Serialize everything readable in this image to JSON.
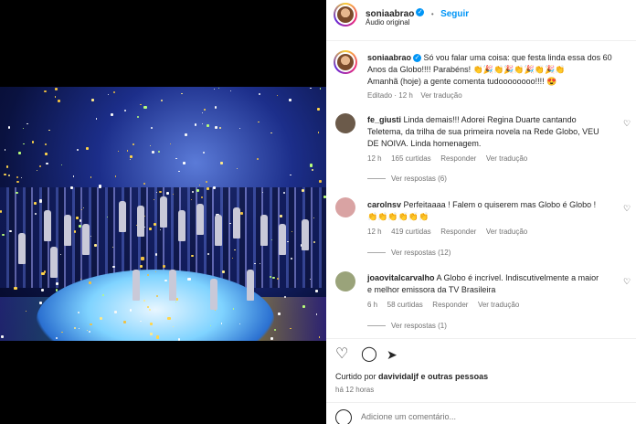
{
  "header": {
    "username": "soniaabrao",
    "follow_label": "Seguir",
    "subtitle": "Áudio original",
    "dot": "•"
  },
  "caption": {
    "username": "soniaabrao",
    "text_line1": "Só vou falar uma coisa: que festa linda essa dos 60",
    "text_line2": "Anos da Globo!!!! Parabéns! 👏🎉👏🎉👏🎉👏🎉👏",
    "text_line3": "Amanhã (hoje) a gente comenta tudoooooooo!!!! 😍",
    "meta_edited": "Editado · 12 h",
    "meta_translate": "Ver tradução"
  },
  "comments": [
    {
      "username": "fe_giusti",
      "line1": "Linda demais!!! Adorei Regina Duarte cantando",
      "line2": "Teletema, da trilha de sua primeira novela na Rede Globo, VEU",
      "line3": "DE NOIVA. Linda homenagem.",
      "time": "12 h",
      "likes": "165 curtidas",
      "reply": "Responder",
      "translate": "Ver tradução",
      "view_replies": "Ver respostas (6)"
    },
    {
      "username": "carolnsv",
      "line1": "Perfeitaaaa ! Falem o quiserem mas Globo é Globo !",
      "line2": "👏👏👏👏👏👏",
      "line3": "",
      "time": "12 h",
      "likes": "419 curtidas",
      "reply": "Responder",
      "translate": "Ver tradução",
      "view_replies": "Ver respostas (12)"
    },
    {
      "username": "joaovitalcarvalho",
      "line1": "A Globo é incrível. Indiscutivelmente a maior",
      "line2": "e melhor emissora da TV Brasileira",
      "line3": "",
      "time": "6 h",
      "likes": "58 curtidas",
      "reply": "Responder",
      "translate": "Ver tradução",
      "view_replies": "Ver respostas (1)"
    }
  ],
  "footer": {
    "liked_by_prefix": "Curtido por ",
    "liked_by_user": "davividaljf",
    "liked_by_suffix": " e outras pessoas",
    "time": "há 12 horas",
    "add_comment_placeholder": "Adicione um comentário..."
  },
  "icons": {
    "heart": "♡",
    "comment": "◯",
    "share": "➤",
    "mute": "🔇"
  },
  "colors": {
    "accent": "#0095f6",
    "muted": "#737373",
    "text": "#262626"
  }
}
